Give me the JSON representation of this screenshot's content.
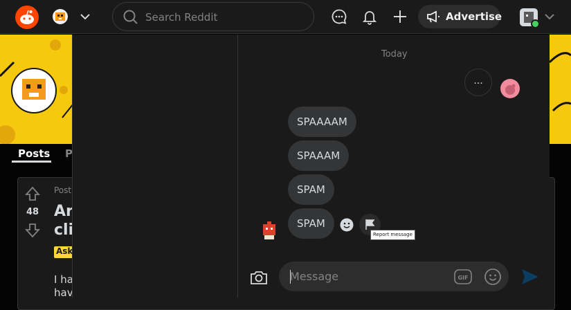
{
  "header": {
    "search_placeholder": "Search Reddit",
    "advertise_label": "Advertise",
    "icons": [
      "reddit-logo",
      "chevron-down-icon",
      "search-icon",
      "chat-icon",
      "bell-icon",
      "plus-icon",
      "megaphone-icon",
      "user-avatar",
      "chevron-down-icon"
    ]
  },
  "subreddit": {
    "tabs": [
      "Posts",
      "P"
    ],
    "post": {
      "meta": "Post",
      "vote_count": "48",
      "title_line1": "Are",
      "title_line2": "cli",
      "flair": "Ask",
      "body_line1": "I ha",
      "body_line2": "hav"
    }
  },
  "chat": {
    "day_label": "Today",
    "more_label": "...",
    "messages": [
      {
        "text": "SPAAAAM"
      },
      {
        "text": "SPAAAM"
      },
      {
        "text": "SPAM"
      },
      {
        "text": "SPAM"
      }
    ],
    "tooltip": "Report message",
    "input_placeholder": "Message",
    "gif_label": "GIF"
  },
  "colors": {
    "accent": "#ff4500",
    "bubble": "#343536",
    "background": "#1a1a1b",
    "send": "#0079d3",
    "online": "#46d160"
  }
}
